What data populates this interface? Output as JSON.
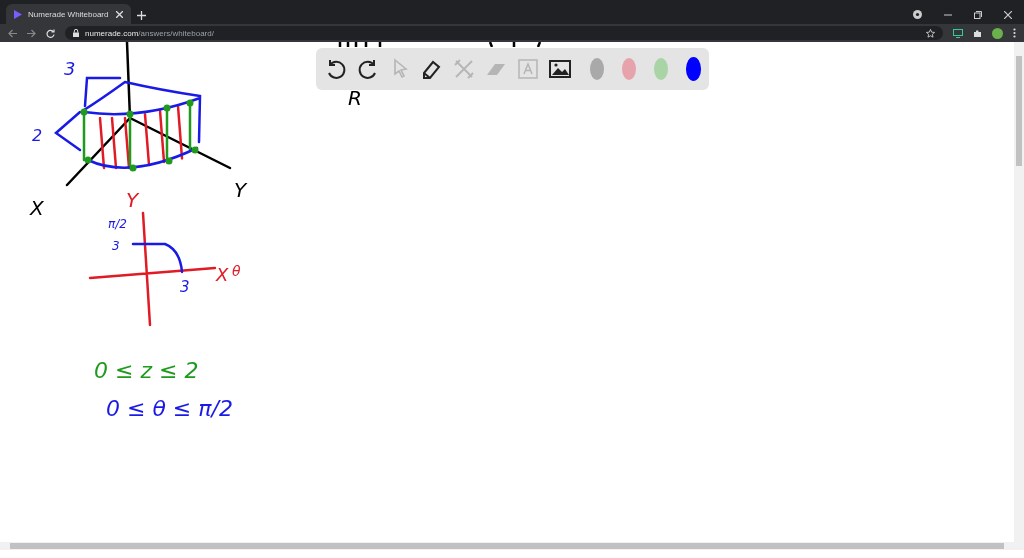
{
  "browser": {
    "tab": {
      "title": "Numerade Whiteboard",
      "selected": true
    },
    "url": {
      "host": "numerade.com",
      "path": "/answers/whiteboard/"
    }
  },
  "toolbar": {
    "tools": [
      {
        "kind": "undo",
        "disabled": false
      },
      {
        "kind": "redo",
        "disabled": false
      },
      {
        "kind": "select",
        "disabled": true
      },
      {
        "kind": "pen",
        "disabled": false
      },
      {
        "kind": "tools",
        "disabled": true
      },
      {
        "kind": "eraser",
        "disabled": true
      },
      {
        "kind": "text",
        "disabled": true
      },
      {
        "kind": "image",
        "disabled": false
      }
    ],
    "colors": [
      {
        "color": "#a9a9a9",
        "selected": false
      },
      {
        "color": "#e6a3ab",
        "selected": false
      },
      {
        "color": "#a9d4a5",
        "selected": false
      },
      {
        "color": "#0000ff",
        "selected": true
      }
    ]
  },
  "annotations": [
    {
      "text": "3",
      "color": "#1a1ae6"
    },
    {
      "text": "R",
      "color": "#000000"
    },
    {
      "text": "2",
      "color": "#1a1ae6"
    },
    {
      "text": "X",
      "color": "#000000"
    },
    {
      "text": "Y",
      "color": "#e01b24"
    },
    {
      "text": "Y",
      "color": "#000000"
    },
    {
      "text": "π/2",
      "color": "#1a1ae6"
    },
    {
      "text": "3",
      "color": "#1a1ae6"
    },
    {
      "text": "X",
      "color": "#e01b24"
    },
    {
      "text": "θ",
      "color": "#e01b24"
    },
    {
      "text": "3",
      "color": "#1a1ae6"
    },
    {
      "text": "0 ≤ z ≤ 2",
      "color": "#1f9a1f"
    },
    {
      "text": "0 ≤ θ ≤ π/2",
      "color": "#1a1ae6"
    }
  ]
}
